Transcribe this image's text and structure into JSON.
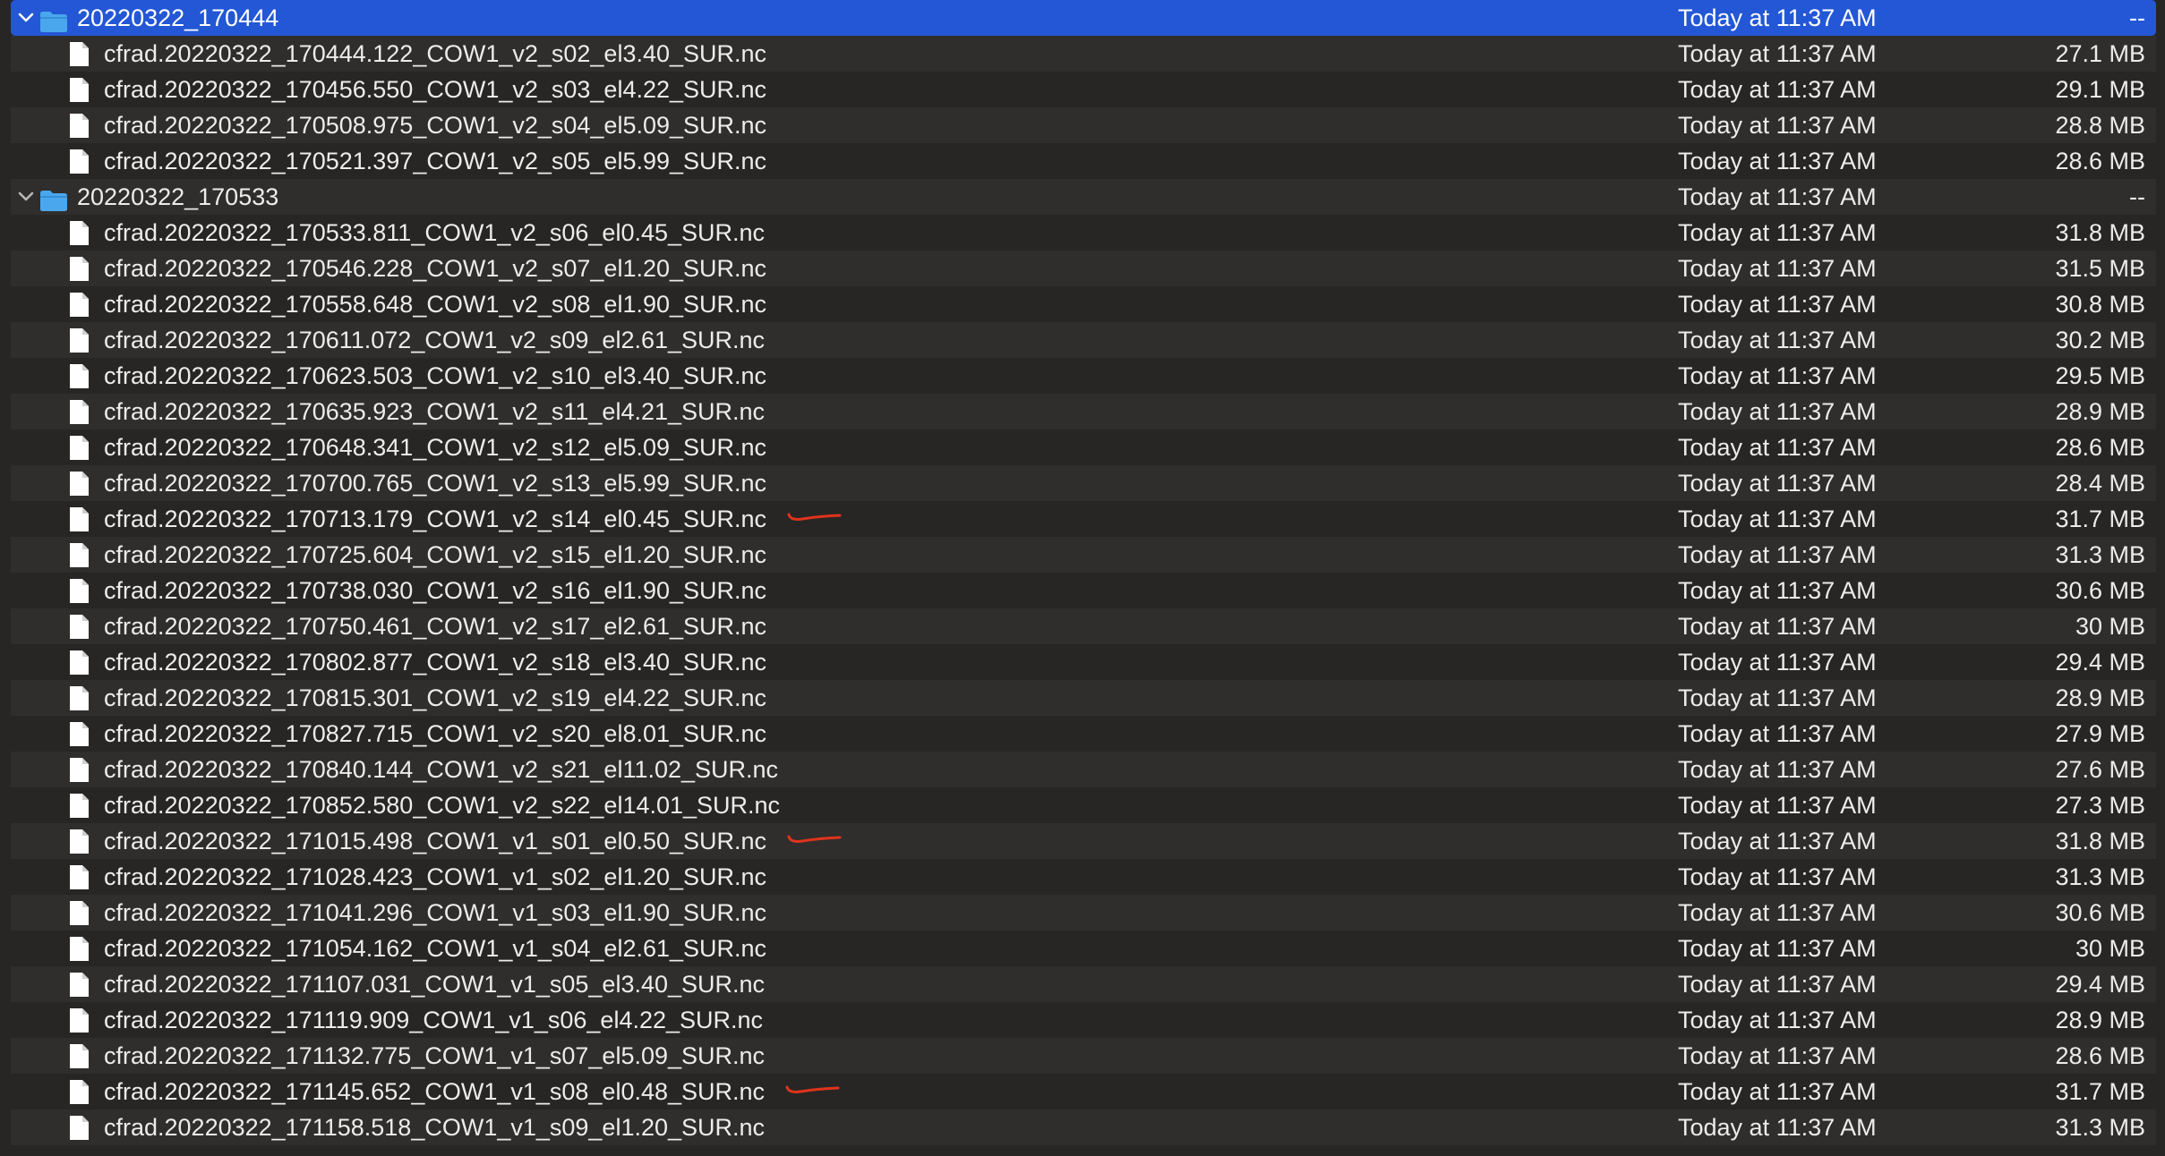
{
  "rows": [
    {
      "kind": "folder",
      "expanded": true,
      "selected": true,
      "name": "20220322_170444",
      "date": "Today at 11:37 AM",
      "size": "--"
    },
    {
      "kind": "file",
      "name": "cfrad.20220322_170444.122_COW1_v2_s02_el3.40_SUR.nc",
      "date": "Today at 11:37 AM",
      "size": "27.1 MB"
    },
    {
      "kind": "file",
      "name": "cfrad.20220322_170456.550_COW1_v2_s03_el4.22_SUR.nc",
      "date": "Today at 11:37 AM",
      "size": "29.1 MB"
    },
    {
      "kind": "file",
      "name": "cfrad.20220322_170508.975_COW1_v2_s04_el5.09_SUR.nc",
      "date": "Today at 11:37 AM",
      "size": "28.8 MB"
    },
    {
      "kind": "file",
      "name": "cfrad.20220322_170521.397_COW1_v2_s05_el5.99_SUR.nc",
      "date": "Today at 11:37 AM",
      "size": "28.6 MB"
    },
    {
      "kind": "folder",
      "expanded": true,
      "selected": false,
      "name": "20220322_170533",
      "date": "Today at 11:37 AM",
      "size": "--"
    },
    {
      "kind": "file",
      "name": "cfrad.20220322_170533.811_COW1_v2_s06_el0.45_SUR.nc",
      "date": "Today at 11:37 AM",
      "size": "31.8 MB"
    },
    {
      "kind": "file",
      "name": "cfrad.20220322_170546.228_COW1_v2_s07_el1.20_SUR.nc",
      "date": "Today at 11:37 AM",
      "size": "31.5 MB"
    },
    {
      "kind": "file",
      "name": "cfrad.20220322_170558.648_COW1_v2_s08_el1.90_SUR.nc",
      "date": "Today at 11:37 AM",
      "size": "30.8 MB"
    },
    {
      "kind": "file",
      "name": "cfrad.20220322_170611.072_COW1_v2_s09_el2.61_SUR.nc",
      "date": "Today at 11:37 AM",
      "size": "30.2 MB"
    },
    {
      "kind": "file",
      "name": "cfrad.20220322_170623.503_COW1_v2_s10_el3.40_SUR.nc",
      "date": "Today at 11:37 AM",
      "size": "29.5 MB"
    },
    {
      "kind": "file",
      "name": "cfrad.20220322_170635.923_COW1_v2_s11_el4.21_SUR.nc",
      "date": "Today at 11:37 AM",
      "size": "28.9 MB"
    },
    {
      "kind": "file",
      "name": "cfrad.20220322_170648.341_COW1_v2_s12_el5.09_SUR.nc",
      "date": "Today at 11:37 AM",
      "size": "28.6 MB"
    },
    {
      "kind": "file",
      "name": "cfrad.20220322_170700.765_COW1_v2_s13_el5.99_SUR.nc",
      "date": "Today at 11:37 AM",
      "size": "28.4 MB"
    },
    {
      "kind": "file",
      "name": "cfrad.20220322_170713.179_COW1_v2_s14_el0.45_SUR.nc",
      "date": "Today at 11:37 AM",
      "size": "31.7 MB",
      "marked": true
    },
    {
      "kind": "file",
      "name": "cfrad.20220322_170725.604_COW1_v2_s15_el1.20_SUR.nc",
      "date": "Today at 11:37 AM",
      "size": "31.3 MB"
    },
    {
      "kind": "file",
      "name": "cfrad.20220322_170738.030_COW1_v2_s16_el1.90_SUR.nc",
      "date": "Today at 11:37 AM",
      "size": "30.6 MB"
    },
    {
      "kind": "file",
      "name": "cfrad.20220322_170750.461_COW1_v2_s17_el2.61_SUR.nc",
      "date": "Today at 11:37 AM",
      "size": "30 MB"
    },
    {
      "kind": "file",
      "name": "cfrad.20220322_170802.877_COW1_v2_s18_el3.40_SUR.nc",
      "date": "Today at 11:37 AM",
      "size": "29.4 MB"
    },
    {
      "kind": "file",
      "name": "cfrad.20220322_170815.301_COW1_v2_s19_el4.22_SUR.nc",
      "date": "Today at 11:37 AM",
      "size": "28.9 MB"
    },
    {
      "kind": "file",
      "name": "cfrad.20220322_170827.715_COW1_v2_s20_el8.01_SUR.nc",
      "date": "Today at 11:37 AM",
      "size": "27.9 MB"
    },
    {
      "kind": "file",
      "name": "cfrad.20220322_170840.144_COW1_v2_s21_el11.02_SUR.nc",
      "date": "Today at 11:37 AM",
      "size": "27.6 MB"
    },
    {
      "kind": "file",
      "name": "cfrad.20220322_170852.580_COW1_v2_s22_el14.01_SUR.nc",
      "date": "Today at 11:37 AM",
      "size": "27.3 MB"
    },
    {
      "kind": "file",
      "name": "cfrad.20220322_171015.498_COW1_v1_s01_el0.50_SUR.nc",
      "date": "Today at 11:37 AM",
      "size": "31.8 MB",
      "marked": true
    },
    {
      "kind": "file",
      "name": "cfrad.20220322_171028.423_COW1_v1_s02_el1.20_SUR.nc",
      "date": "Today at 11:37 AM",
      "size": "31.3 MB"
    },
    {
      "kind": "file",
      "name": "cfrad.20220322_171041.296_COW1_v1_s03_el1.90_SUR.nc",
      "date": "Today at 11:37 AM",
      "size": "30.6 MB"
    },
    {
      "kind": "file",
      "name": "cfrad.20220322_171054.162_COW1_v1_s04_el2.61_SUR.nc",
      "date": "Today at 11:37 AM",
      "size": "30 MB"
    },
    {
      "kind": "file",
      "name": "cfrad.20220322_171107.031_COW1_v1_s05_el3.40_SUR.nc",
      "date": "Today at 11:37 AM",
      "size": "29.4 MB"
    },
    {
      "kind": "file",
      "name": "cfrad.20220322_171119.909_COW1_v1_s06_el4.22_SUR.nc",
      "date": "Today at 11:37 AM",
      "size": "28.9 MB"
    },
    {
      "kind": "file",
      "name": "cfrad.20220322_171132.775_COW1_v1_s07_el5.09_SUR.nc",
      "date": "Today at 11:37 AM",
      "size": "28.6 MB"
    },
    {
      "kind": "file",
      "name": "cfrad.20220322_171145.652_COW1_v1_s08_el0.48_SUR.nc",
      "date": "Today at 11:37 AM",
      "size": "31.7 MB",
      "marked": true
    },
    {
      "kind": "file",
      "name": "cfrad.20220322_171158.518_COW1_v1_s09_el1.20_SUR.nc",
      "date": "Today at 11:37 AM",
      "size": "31.3 MB"
    },
    {
      "kind": "folder",
      "expanded": false,
      "selected": false,
      "partial": true,
      "name": "",
      "date": "",
      "size": ""
    }
  ],
  "colors": {
    "background": "#282624",
    "row_alt": "#302e2c",
    "selection": "#2357d6",
    "folder_icon": "#4aa7ee",
    "annotation_mark": "#e0331c"
  },
  "icons": {
    "folder": "folder-icon",
    "file": "document-icon",
    "disclosure": "chevron-down-icon"
  }
}
